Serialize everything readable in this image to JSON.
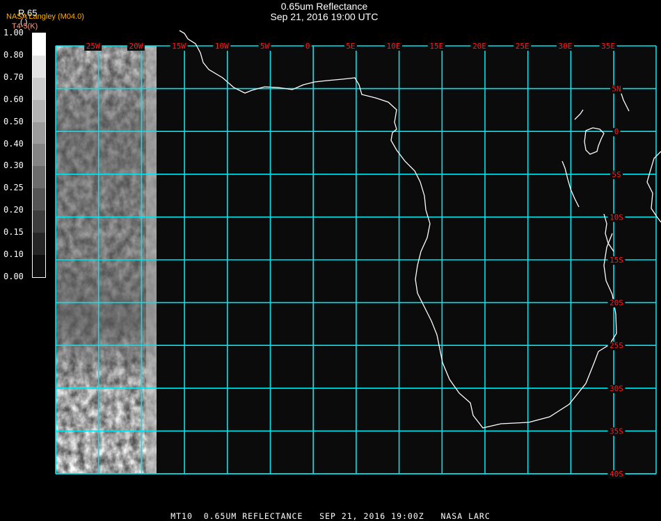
{
  "title": {
    "line1": "0.65um Reflectance",
    "line2": "Sep 21, 2016 19:00 UTC"
  },
  "legend": {
    "channel": "R.65",
    "units": "(  )",
    "source": "NASA Langley (M04.0)",
    "aux": "T4-5(K)",
    "source_color": "#ffb000",
    "aux_color": "#ffa080",
    "ticks": [
      "1.00",
      "0.80",
      "0.70",
      "0.60",
      "0.50",
      "0.40",
      "0.30",
      "0.25",
      "0.20",
      "0.15",
      "0.10",
      "0.00"
    ],
    "shades": [
      "#ffffff",
      "#e3e3e3",
      "#cbcbcb",
      "#b3b3b3",
      "#9b9b9b",
      "#848484",
      "#6c6c6c",
      "#555555",
      "#3d3d3d",
      "#262626",
      "#0e0e0e"
    ]
  },
  "map": {
    "grid_color": "#00e5ee",
    "label_color": "#ff1a1a",
    "lon_labels": [
      "25W",
      "20W",
      "15W",
      "10W",
      "5W",
      "0",
      "5E",
      "10E",
      "15E",
      "20E",
      "25E",
      "30E",
      "35E"
    ],
    "lat_labels": [
      "5N",
      "0",
      "5S",
      "10S",
      "15S",
      "20S",
      "25S",
      "30S",
      "35S",
      "40S"
    ]
  },
  "footer": "MT10  0.65UM REFLECTANCE   SEP 21, 2016 19:00Z   NASA LARC"
}
